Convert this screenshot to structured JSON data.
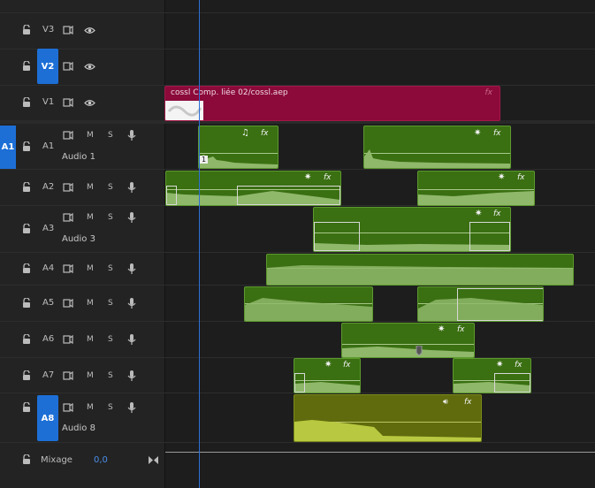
{
  "video_tracks": [
    {
      "label": "V3",
      "targeted": false
    },
    {
      "label": "V2",
      "targeted": true
    },
    {
      "label": "V1",
      "targeted": false
    }
  ],
  "audio_tracks": [
    {
      "label": "A1",
      "name": "Audio 1",
      "source_patch": "A1"
    },
    {
      "label": "A2",
      "name": ""
    },
    {
      "label": "A3",
      "name": "Audio 3"
    },
    {
      "label": "A4",
      "name": ""
    },
    {
      "label": "A5",
      "name": ""
    },
    {
      "label": "A6",
      "name": ""
    },
    {
      "label": "A7",
      "name": ""
    },
    {
      "label": "A8",
      "name": "Audio 8",
      "targeted": true
    }
  ],
  "track_controls": {
    "mute": "M",
    "solo": "S"
  },
  "mix": {
    "label": "Mixage",
    "value": "0,0"
  },
  "clips": {
    "v1_clip_name": "cossl Comp. liée 02/cossl.aep",
    "fx": "fx",
    "a1_badge": "1"
  },
  "colors": {
    "accent": "#1d6fd6",
    "audio_clip": "#3a6f12",
    "video_clip": "#8b0a3a",
    "selected_audio_clip": "#5f6b0d"
  }
}
